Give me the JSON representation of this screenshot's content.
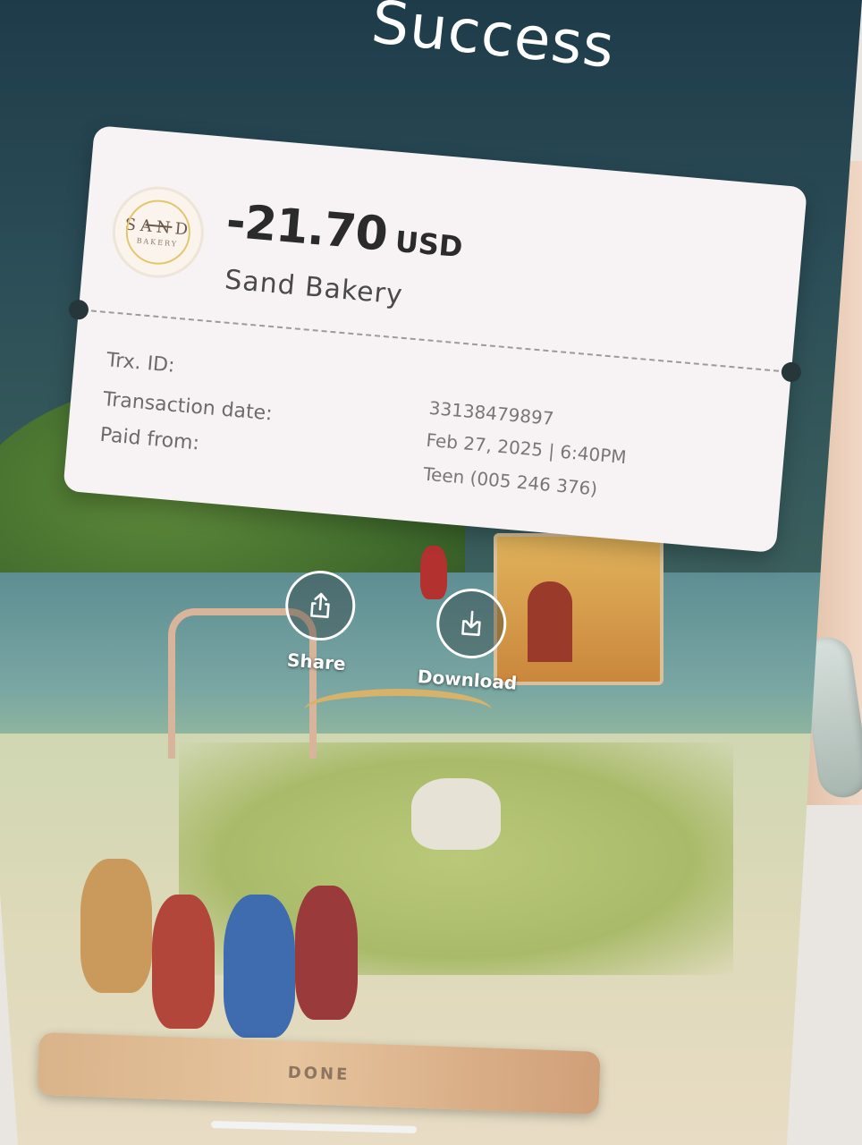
{
  "header": {
    "title": "Success"
  },
  "receipt": {
    "logo": {
      "word": "SAND",
      "sub": "BAKERY"
    },
    "amount": "-21.70",
    "currency": "USD",
    "merchant": "Sand Bakery",
    "fields": [
      {
        "label": "Trx. ID:",
        "value": "33138479897"
      },
      {
        "label": "Transaction date:",
        "value": "Feb 27, 2025 | 6:40PM"
      },
      {
        "label": "Paid from:",
        "value": "Teen (005 246 376)"
      }
    ]
  },
  "actions": {
    "share_label": "Share",
    "download_label": "Download"
  },
  "done_label": "DONE",
  "icons": [
    "share-icon",
    "download-icon"
  ],
  "colors": {
    "card": "#f7f3f4",
    "done_button": "#e0bb93",
    "header_bg": "#1e3b49"
  }
}
